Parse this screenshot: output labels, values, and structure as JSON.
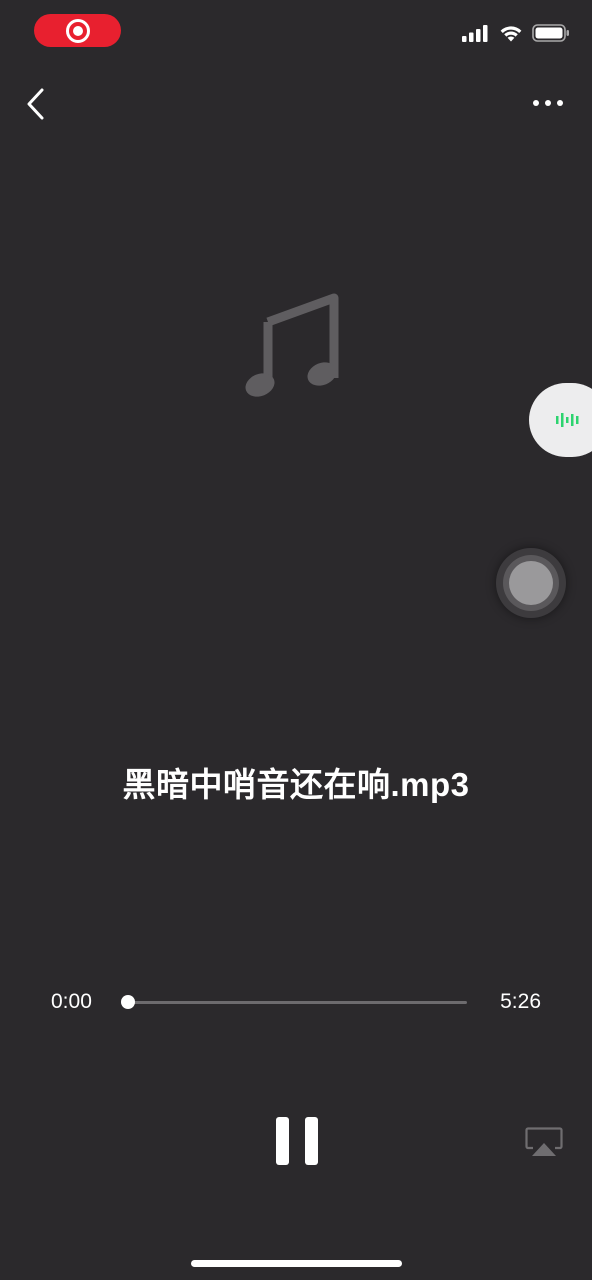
{
  "status_bar": {
    "recording_icon": "screen-record-icon",
    "recording_color": "#e8202f",
    "signal_icon": "cellular-signal-icon",
    "wifi_icon": "wifi-icon",
    "battery_icon": "battery-icon"
  },
  "nav": {
    "back_icon": "chevron-left-icon",
    "more_icon": "ellipsis-icon"
  },
  "artwork": {
    "icon": "music-note-icon"
  },
  "floating_widget": {
    "icon": "audio-waveform-icon",
    "accent_color": "#2dd36f"
  },
  "assistive_touch": {
    "icon": "assistive-touch-icon"
  },
  "track": {
    "title": "黑暗中哨音还在响.mp3"
  },
  "player": {
    "current_time": "0:00",
    "total_time": "5:26",
    "progress_fraction": 0.0,
    "pause_icon": "pause-icon",
    "airplay_icon": "airplay-icon"
  }
}
